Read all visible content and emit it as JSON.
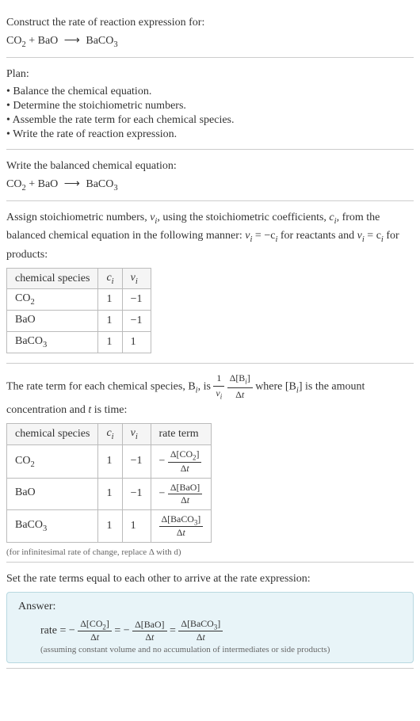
{
  "intro": {
    "prompt": "Construct the rate of reaction expression for:",
    "eq_lhs1": "CO",
    "eq_lhs1_sub": "2",
    "plus": " + ",
    "eq_lhs2": "BaO",
    "arrow": "⟶",
    "eq_rhs": "BaCO",
    "eq_rhs_sub": "3"
  },
  "plan": {
    "title": "Plan:",
    "items": [
      "• Balance the chemical equation.",
      "• Determine the stoichiometric numbers.",
      "• Assemble the rate term for each chemical species.",
      "• Write the rate of reaction expression."
    ]
  },
  "balanced": {
    "title": "Write the balanced chemical equation:"
  },
  "stoich": {
    "text1": "Assign stoichiometric numbers, ",
    "nu": "ν",
    "sub_i": "i",
    "text2": ", using the stoichiometric coefficients, ",
    "c": "c",
    "text3": ", from the balanced chemical equation in the following manner: ",
    "eq1": "ν",
    "eq1b": " = −c",
    "text4": " for reactants and ",
    "eq2": "ν",
    "eq2b": " = c",
    "text5": " for products:",
    "table": {
      "headers": [
        "chemical species",
        "c",
        "ν"
      ],
      "sub_i": "i",
      "rows": [
        {
          "species": "CO",
          "sub": "2",
          "c": "1",
          "nu": "−1"
        },
        {
          "species": "BaO",
          "sub": "",
          "c": "1",
          "nu": "−1"
        },
        {
          "species": "BaCO",
          "sub": "3",
          "c": "1",
          "nu": "1"
        }
      ]
    }
  },
  "rate_term": {
    "text1": "The rate term for each chemical species, B",
    "sub_i": "i",
    "text2": ", is ",
    "one": "1",
    "nu": "ν",
    "delta_b": "Δ[B",
    "close_br": "]",
    "dt": "Δt",
    "text3": " where [B",
    "text4": "] is the amount concentration and ",
    "t": "t",
    "text5": " is time:",
    "table": {
      "headers": [
        "chemical species",
        "c",
        "ν",
        "rate term"
      ],
      "rows": [
        {
          "species": "CO",
          "sub": "2",
          "c": "1",
          "nu": "−1",
          "neg": "−",
          "num": "Δ[CO",
          "num_sub": "2",
          "num_end": "]",
          "den": "Δt"
        },
        {
          "species": "BaO",
          "sub": "",
          "c": "1",
          "nu": "−1",
          "neg": "−",
          "num": "Δ[BaO]",
          "num_sub": "",
          "num_end": "",
          "den": "Δt"
        },
        {
          "species": "BaCO",
          "sub": "3",
          "c": "1",
          "nu": "1",
          "neg": "",
          "num": "Δ[BaCO",
          "num_sub": "3",
          "num_end": "]",
          "den": "Δt"
        }
      ]
    },
    "note": "(for infinitesimal rate of change, replace Δ with d)"
  },
  "final": {
    "title": "Set the rate terms equal to each other to arrive at the rate expression:",
    "answer_label": "Answer:",
    "rate": "rate = ",
    "neg": "−",
    "t1n": "Δ[CO",
    "t1sub": "2",
    "t1end": "]",
    "t1d": "Δt",
    "eq": " = ",
    "t2n": "Δ[BaO]",
    "t2d": "Δt",
    "t3n": "Δ[BaCO",
    "t3sub": "3",
    "t3end": "]",
    "t3d": "Δt",
    "note": "(assuming constant volume and no accumulation of intermediates or side products)"
  }
}
